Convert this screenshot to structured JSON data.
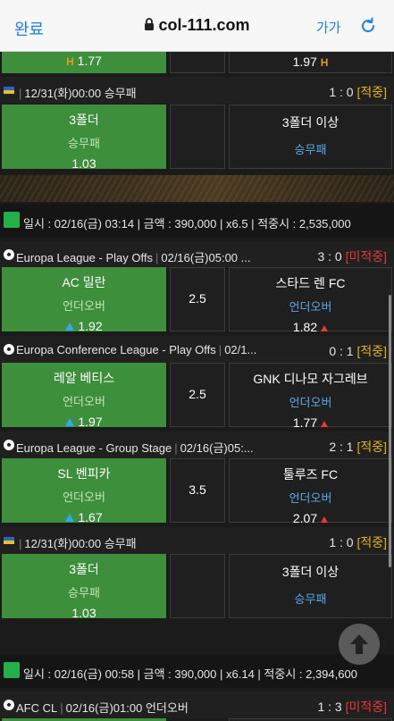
{
  "browser": {
    "done": "완료",
    "url": "col-111.com",
    "text_size": "가가"
  },
  "top_partial": {
    "left_odd": "1.77",
    "right_odd": "1.97",
    "mark": "H"
  },
  "bet1_game": {
    "datetime": "12/31(화)00:00",
    "market": "승무패",
    "score": "1 : 0",
    "status": "[적중]",
    "home": {
      "team": "3폴더",
      "type": "승무패",
      "odd": "1.03"
    },
    "away": {
      "team": "3폴더 이상",
      "type": "승무패"
    }
  },
  "bet2_summary": {
    "text": "일시 : 02/16(금) 03:14 | 금액 : 390,000 | x6.5 | 적중시 : 2,535,000"
  },
  "bet2_game1": {
    "league": "Europa League - Play Offs",
    "datetime": "02/16(금)05:00 ...",
    "score": "3 : 0",
    "status": "[미적중]",
    "home": {
      "team": "AC 밀란",
      "type": "언더오버",
      "odd": "1.92"
    },
    "line": "2.5",
    "away": {
      "team": "스타드 렌 FC",
      "type": "언더오버",
      "odd": "1.82"
    }
  },
  "bet2_game2": {
    "league": "Europa Conference League - Play Offs",
    "datetime": "02/1...",
    "score": "0 : 1",
    "status": "[적중]",
    "home": {
      "team": "레알 베티스",
      "type": "언더오버",
      "odd": "1.97"
    },
    "line": "2.5",
    "away": {
      "team": "GNK 디나모 자그레브",
      "type": "언더오버",
      "odd": "1.77"
    }
  },
  "bet2_game3": {
    "league": "Europa League - Group Stage",
    "datetime": "02/16(금)05:...",
    "score": "2 : 1",
    "status": "[적중]",
    "home": {
      "team": "SL 벤피카",
      "type": "언더오버",
      "odd": "1.67"
    },
    "line": "3.5",
    "away": {
      "team": "툴루즈 FC",
      "type": "언더오버",
      "odd": "2.07"
    }
  },
  "bet2_game4": {
    "datetime": "12/31(화)00:00",
    "market": "승무패",
    "score": "1 : 0",
    "status": "[적중]",
    "home": {
      "team": "3폴더",
      "type": "승무패",
      "odd": "1.03"
    },
    "away": {
      "team": "3폴더 이상",
      "type": "승무패"
    }
  },
  "bet3_summary": {
    "text": "일시 : 02/16(금) 00:58 | 금액 : 390,000 | x6.14 | 적중시 : 2,394,600"
  },
  "bet3_game1": {
    "league": "AFC CL",
    "datetime": "02/16(금)01:00",
    "market": "언더오버",
    "score": "1 : 3",
    "status": "[미적중]"
  },
  "colors": {
    "green_cell": "#3d8f3c",
    "hit": "#e2b419",
    "miss": "#e53935",
    "link": "#1a7ef2"
  }
}
